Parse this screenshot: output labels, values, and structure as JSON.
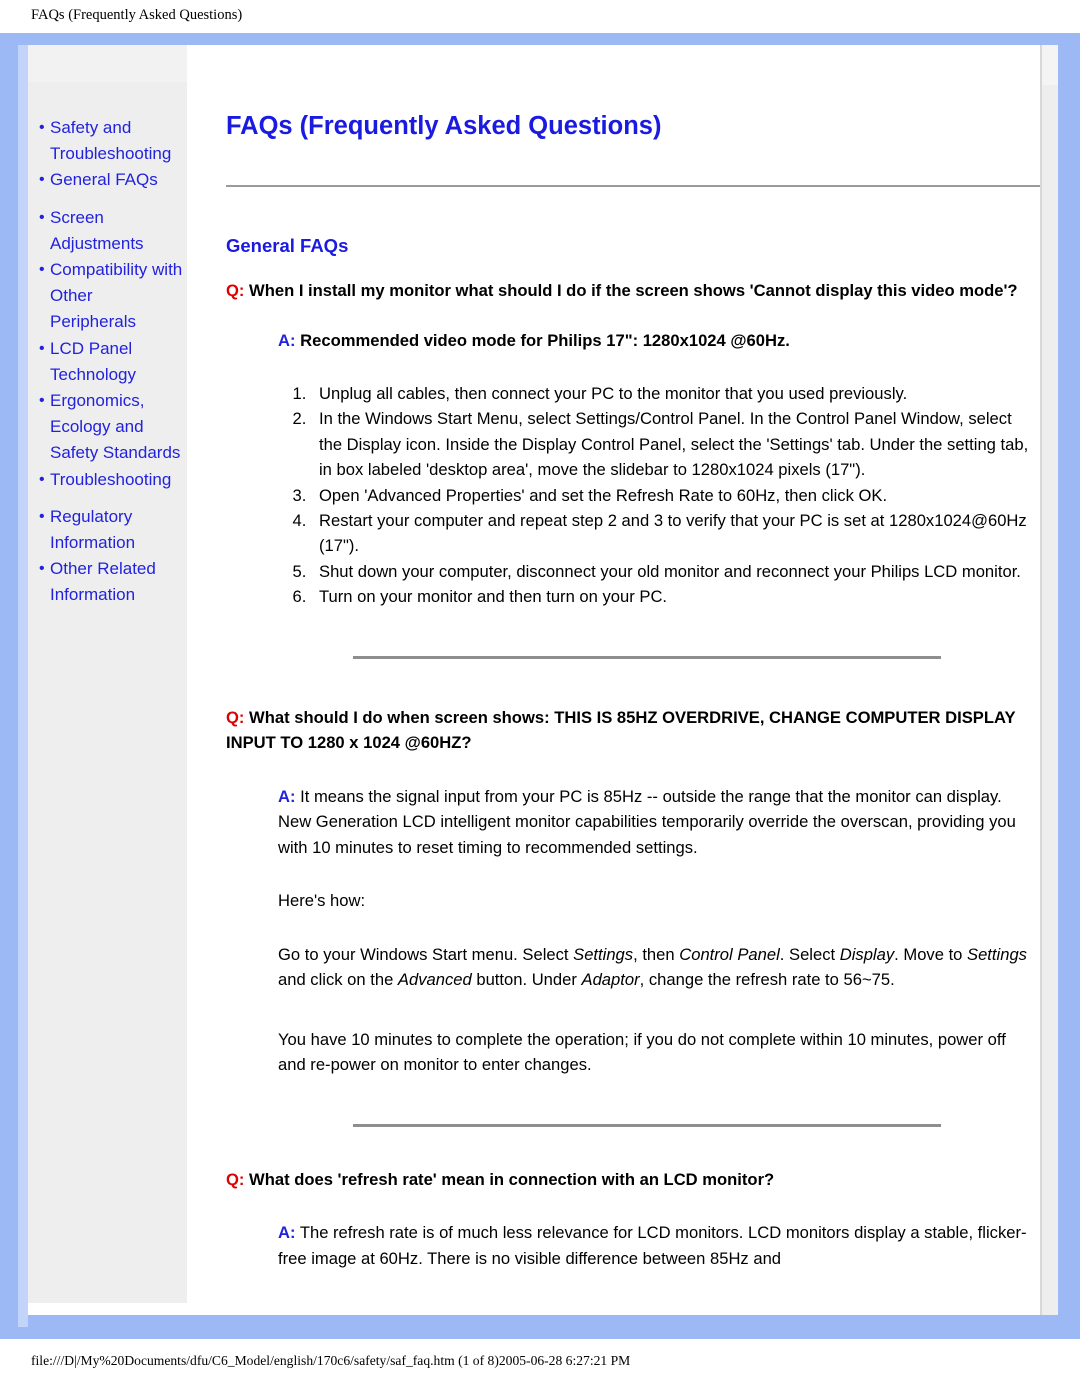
{
  "page_header": "FAQs (Frequently Asked Questions)",
  "sidebar": {
    "items": [
      {
        "label": "Safety and Troubleshooting",
        "gap_before": false
      },
      {
        "label": "General FAQs",
        "gap_before": false
      },
      {
        "label": "Screen Adjustments",
        "gap_before": true
      },
      {
        "label": "Compatibility with Other Peripherals",
        "gap_before": false
      },
      {
        "label": "LCD Panel Technology",
        "gap_before": false
      },
      {
        "label": "Ergonomics, Ecology and Safety Standards",
        "gap_before": false
      },
      {
        "label": "Troubleshooting",
        "gap_before": false
      },
      {
        "label": "Regulatory Information",
        "gap_before": true
      },
      {
        "label": "Other Related Information",
        "gap_before": false
      }
    ],
    "bullet": "•"
  },
  "main": {
    "title": "FAQs (Frequently Asked Questions)",
    "section_title": "General FAQs",
    "q_prefix": "Q:",
    "a_prefix": "A:",
    "q1": {
      "question": " When I install my monitor what should I do if the screen shows 'Cannot display this video mode'?",
      "answer": " Recommended video mode for Philips 17\": 1280x1024 @60Hz.",
      "steps": [
        "Unplug all cables, then connect your PC to the monitor that you used previously.",
        "In the Windows Start Menu, select Settings/Control Panel. In the Control Panel Window, select the Display icon. Inside the Display Control Panel, select the 'Settings' tab. Under the setting tab, in box labeled 'desktop area', move the slidebar to 1280x1024 pixels (17\").",
        "Open 'Advanced Properties' and set the Refresh Rate to 60Hz, then click OK.",
        "Restart your computer and repeat step 2 and 3 to verify that your PC is set at 1280x1024@60Hz (17\").",
        "Shut down your computer, disconnect your old monitor and reconnect your Philips LCD monitor.",
        "Turn on your monitor and then turn on your PC."
      ]
    },
    "q2": {
      "question": " What should I do when screen shows: THIS IS 85HZ OVERDRIVE, CHANGE COMPUTER DISPLAY INPUT TO 1280 x 1024 @60HZ?",
      "answer": " It means the signal input from your PC is 85Hz -- outside the range that the monitor can display. New Generation LCD intelligent monitor capabilities temporarily override the overscan, providing you with 10 minutes to reset timing to recommended settings.",
      "heres_how": "Here's how:",
      "instruction_parts": {
        "p1": "Go to your Windows Start menu. Select ",
        "i1": "Settings",
        "p2": ", then ",
        "i2": "Control Panel",
        "p3": ". Select ",
        "i3": "Display",
        "p4": ". Move to ",
        "i4": "Settings",
        "p5": " and click on the ",
        "i5": "Advanced",
        "p6": " button. Under ",
        "i6": "Adaptor",
        "p7": ", change the refresh rate to 56~75."
      },
      "closing": "You have 10 minutes to complete the operation; if you do not complete within 10 minutes, power off and re-power on monitor to enter changes."
    },
    "q3": {
      "question": " What does 'refresh rate' mean in connection with an LCD monitor?",
      "answer": " The refresh rate is of much less relevance for LCD monitors. LCD monitors display a stable, flicker-free image at 60Hz. There is no visible difference between 85Hz and"
    }
  },
  "footer": "file:///D|/My%20Documents/dfu/C6_Model/english/170c6/safety/saf_faq.htm (1 of 8)2005-06-28 6:27:21 PM",
  "colors": {
    "frame_blue": "#9cb8f5",
    "link_blue": "#2222dd",
    "heading_blue": "#1a1ae0",
    "q_red": "#e00000",
    "sidebar_gray": "#eeeeee",
    "rule_gray": "#8e8e8e"
  }
}
